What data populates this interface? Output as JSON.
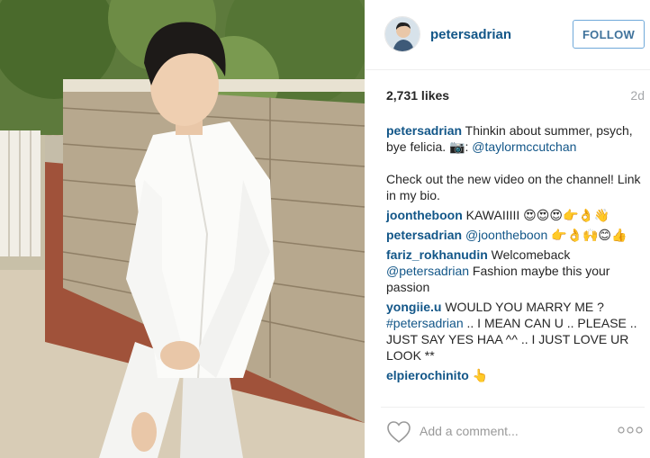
{
  "post": {
    "username": "petersadrian",
    "follow_label": "FOLLOW",
    "likes": "2,731 likes",
    "time": "2d"
  },
  "caption": {
    "user": "petersadrian",
    "text1": " Thinkin about summer, psych, bye felicia. 📷: ",
    "mention": "@taylormccutchan",
    "text2": "Check out the new video on the channel! Link in my bio."
  },
  "comments": [
    {
      "user": "joontheboon",
      "text": " KAWAIIIII 😍😍😍👉👌👋"
    },
    {
      "user": "petersadrian",
      "mention": "@joontheboon",
      "text": " 👉👌🙌😊👍"
    },
    {
      "user": "fariz_rokhanudin",
      "text": " Welcomeback ",
      "mention": "@petersadrian",
      "text2": " Fashion maybe this your passion"
    },
    {
      "user": "yongiie.u",
      "text": " WOULD YOU MARRY ME ? ",
      "mention": "#petersadrian",
      "text2": " .. I MEAN CAN U .. PLEASE .. JUST SAY YES HAA ^^ .. I JUST LOVE UR LOOK **"
    },
    {
      "user": "elpierochinito",
      "text": " 👆"
    }
  ],
  "footer": {
    "add_comment_placeholder": "Add a comment...",
    "heart_icon": "heart-outline-icon",
    "more_icon": "more-options-icon"
  },
  "colors": {
    "username_blue": "#125688",
    "follow_border": "#70a9d9",
    "muted_gray": "#a5a7aa"
  }
}
